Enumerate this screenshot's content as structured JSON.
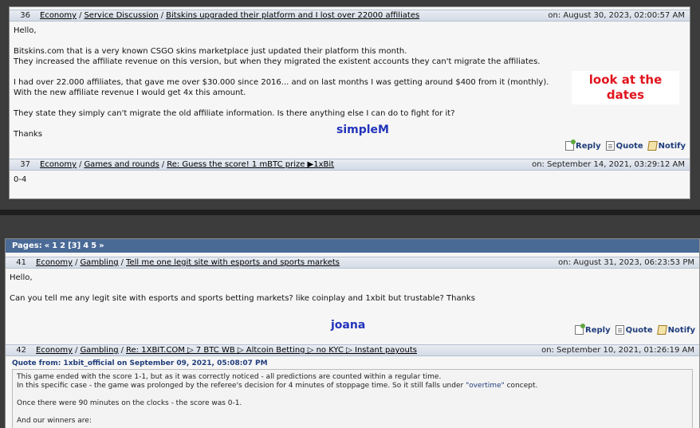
{
  "post36": {
    "number": "36",
    "crumbs": [
      "Economy",
      "Service Discussion",
      "Bitskins upgraded their platform and I lost over 22000 affiliates"
    ],
    "date": "on: August 30, 2023, 02:00:57 AM",
    "lines": [
      "Hello,",
      "",
      "Bitskins.com that is a very known CSGO skins marketplace just updated their platform this month.",
      "They increased the affiliate revenue on this version, but when they migrated the existent accounts they can't migrate the affiliates.",
      "",
      "I had over 22.000 affiliates, that gave me over $30.000 since 2016... and on last months I was getting around $400 from it (monthly).",
      "With the new affiliate revenue I would get 4x this amount.",
      "",
      "They state they simply can't migrate the old affiliate information. Is there anything else I can do to fight for it?",
      "",
      "Thanks"
    ],
    "signature": "simpleM",
    "reply": "Reply",
    "quote": "Quote",
    "notify": "Notify"
  },
  "callout": {
    "line1": "look at the",
    "line2": "dates"
  },
  "post37": {
    "number": "37",
    "crumbs": [
      "Economy",
      "Games and rounds",
      "Re: Guess the score! 1 mBTC prize ▶1xBit"
    ],
    "date": "on: September 14, 2021, 03:29:12 AM",
    "body": "0-4"
  },
  "pager": {
    "label": "Pages:",
    "prev": "«",
    "p1": "1",
    "p2": "2",
    "current": "[3]",
    "p4": "4",
    "p5": "5",
    "next": "»"
  },
  "post41": {
    "number": "41",
    "crumbs": [
      "Economy",
      "Gambling",
      "Tell me one legit site with esports and sports markets"
    ],
    "date": "on: August 31, 2023, 06:23:53 PM",
    "lines": [
      "Hello,",
      "",
      "Can you tell me any legit site with esports and sports betting markets? like coinplay and 1xbit but trustable? Thanks"
    ],
    "signature": "joana",
    "reply": "Reply",
    "quote": "Quote",
    "notify": "Notify"
  },
  "post42": {
    "number": "42",
    "crumbs": [
      "Economy",
      "Gambling",
      "Re: 1XBIT.COM ▷ 7 BTC WB ▷ Altcoin Betting ▷ no KYC ▷ Instant payouts"
    ],
    "date": "on: September 10, 2021, 01:26:19 AM",
    "quote_from": "Quote from: 1xbit_official on September 09, 2021, 05:08:07 PM",
    "quote_line1": "This game ended with the score 1-1, but as it was correctly noticed - all predictions are counted within a regular time.",
    "quote_line2a": "In this specific case - the game was prolonged by the referee's decision for 4 minutes of stoppage time. So it still falls under ",
    "quote_line2b": "\"overtime\"",
    "quote_line2c": " concept.",
    "quote_line3": "Once there were 90 minutes on the clocks - the score was 0-1.",
    "quote_line4": "And our winners are:"
  }
}
